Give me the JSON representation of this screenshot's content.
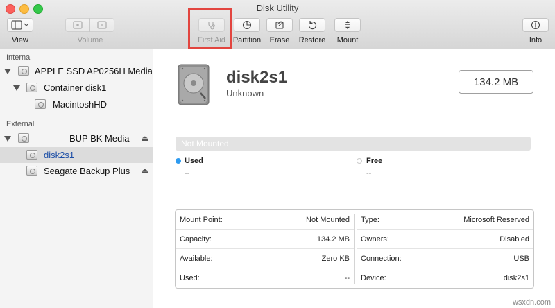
{
  "window": {
    "title": "Disk Utility"
  },
  "toolbar": {
    "view_label": "View",
    "volume_label": "Volume",
    "first_aid_label": "First Aid",
    "partition_label": "Partition",
    "erase_label": "Erase",
    "restore_label": "Restore",
    "mount_label": "Mount",
    "info_label": "Info",
    "highlight_color": "#e2453f"
  },
  "sidebar": {
    "internal_header": "Internal",
    "external_header": "External",
    "items": [
      {
        "label": "APPLE SSD AP0256H Media"
      },
      {
        "label": "Container disk1"
      },
      {
        "label": "MacintoshHD"
      },
      {
        "label": "BUP BK Media"
      },
      {
        "label": "disk2s1"
      },
      {
        "label": "Seagate Backup Plus"
      }
    ]
  },
  "detail": {
    "name": "disk2s1",
    "subtitle": "Unknown",
    "size": "134.2 MB",
    "status": "Not Mounted",
    "used_label": "Used",
    "used_value": "--",
    "free_label": "Free",
    "free_value": "--",
    "used_color": "#2e9bf0",
    "info_left": [
      {
        "key": "Mount Point:",
        "value": "Not Mounted"
      },
      {
        "key": "Capacity:",
        "value": "134.2 MB"
      },
      {
        "key": "Available:",
        "value": "Zero KB"
      },
      {
        "key": "Used:",
        "value": "--"
      }
    ],
    "info_right": [
      {
        "key": "Type:",
        "value": "Microsoft Reserved"
      },
      {
        "key": "Owners:",
        "value": "Disabled"
      },
      {
        "key": "Connection:",
        "value": "USB"
      },
      {
        "key": "Device:",
        "value": "disk2s1"
      }
    ]
  },
  "watermark": "wsxdn.com"
}
